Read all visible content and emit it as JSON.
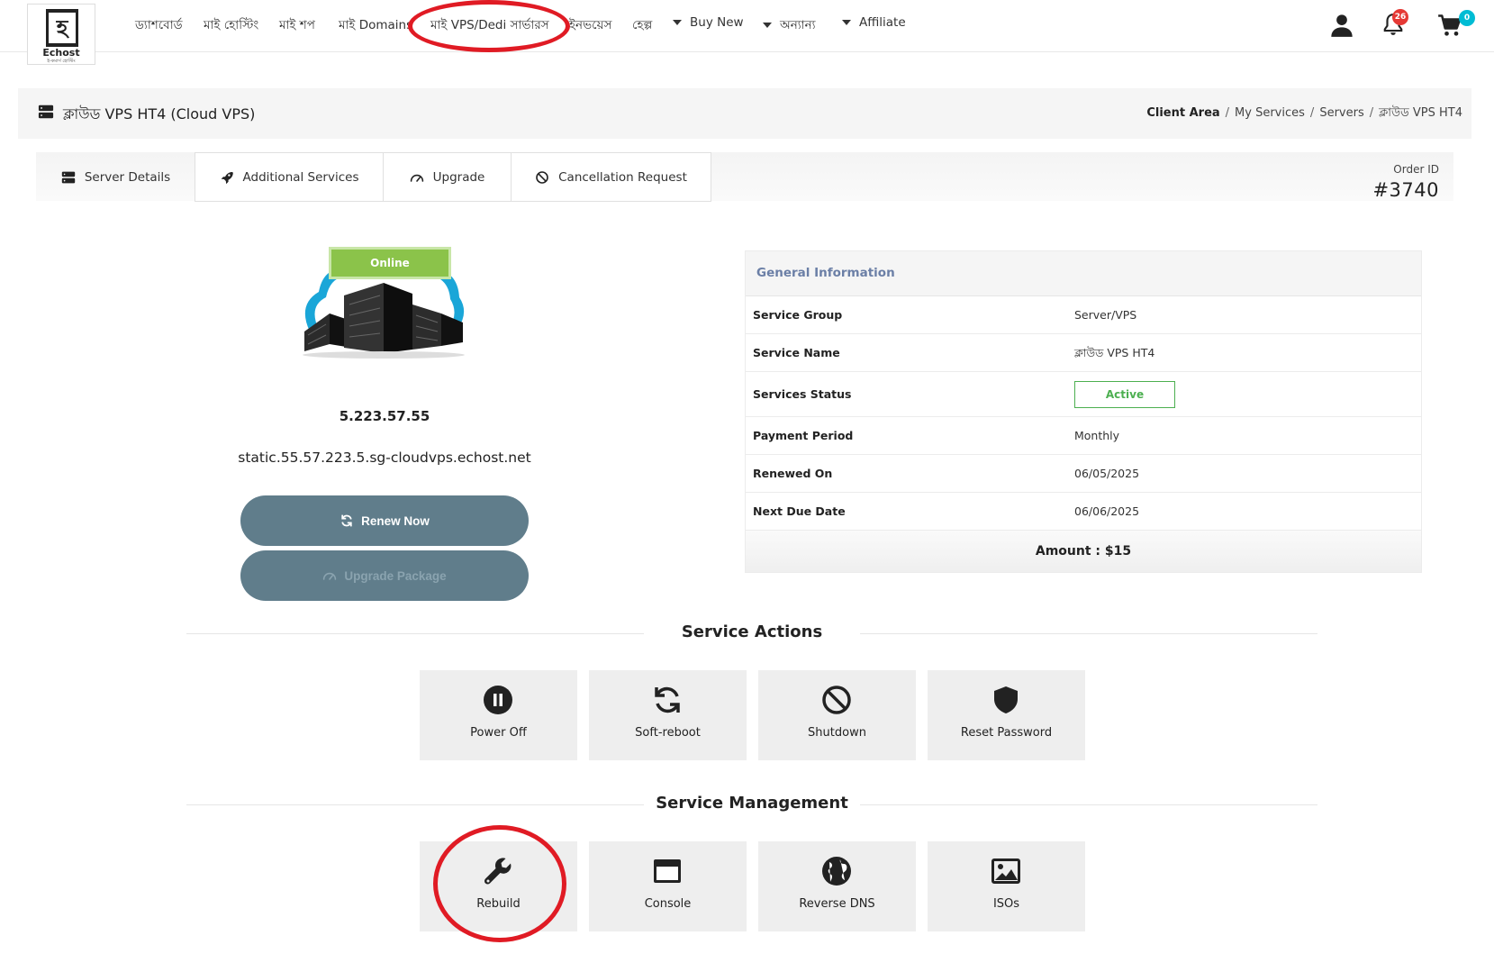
{
  "logo": {
    "glyph": "হ",
    "name": "Echost",
    "tagline": "ই-কমার্স হোস্টিং"
  },
  "nav": {
    "items": [
      "ড্যাশবোর্ড",
      "মাই হোস্টিং",
      "মাই শপ",
      "মাই Domains",
      "মাই VPS/Dedi সার্ভারস",
      "ইনভয়েস",
      "হেল্প"
    ],
    "dropdowns": [
      "Buy New",
      "অন্যান্য",
      "Affiliate"
    ],
    "notification_count": "26",
    "cart_count": "0"
  },
  "header": {
    "title": "ক্লাউড VPS HT4 (Cloud VPS)",
    "breadcrumb": [
      "Client Area",
      "My Services",
      "Servers",
      "ক্লাউড VPS HT4"
    ]
  },
  "tabs": [
    "Server Details",
    "Additional Services",
    "Upgrade",
    "Cancellation Request"
  ],
  "order": {
    "label": "Order ID",
    "id": "#3740"
  },
  "server": {
    "status": "Online",
    "ip": "5.223.57.55",
    "hostname": "static.55.57.223.5.sg-cloudvps.echost.net",
    "renew_label": "Renew Now",
    "upgrade_label": "Upgrade Package"
  },
  "general_info": {
    "title": "General Information",
    "rows": [
      {
        "key": "Service Group",
        "value": "Server/VPS"
      },
      {
        "key": "Service Name",
        "value": "ক্লাউড VPS HT4"
      },
      {
        "key": "Services Status",
        "value": "Active"
      },
      {
        "key": "Payment Period",
        "value": "Monthly"
      },
      {
        "key": "Renewed On",
        "value": "06/05/2025"
      },
      {
        "key": "Next Due Date",
        "value": "06/06/2025"
      }
    ],
    "amount": "Amount : $15"
  },
  "service_actions": {
    "title": "Service Actions",
    "items": [
      "Power Off",
      "Soft-reboot",
      "Shutdown",
      "Reset Password"
    ]
  },
  "service_management": {
    "title": "Service Management",
    "items": [
      "Rebuild",
      "Console",
      "Reverse DNS",
      "ISOs"
    ]
  },
  "colors": {
    "accent_button": "#607d8b",
    "online_green": "#8bc34a",
    "active_green": "#4caf50",
    "info_title": "#6b7fa6",
    "badge_red": "#e53935",
    "badge_teal": "#00bcd4",
    "annotation_red": "#e01b24"
  }
}
